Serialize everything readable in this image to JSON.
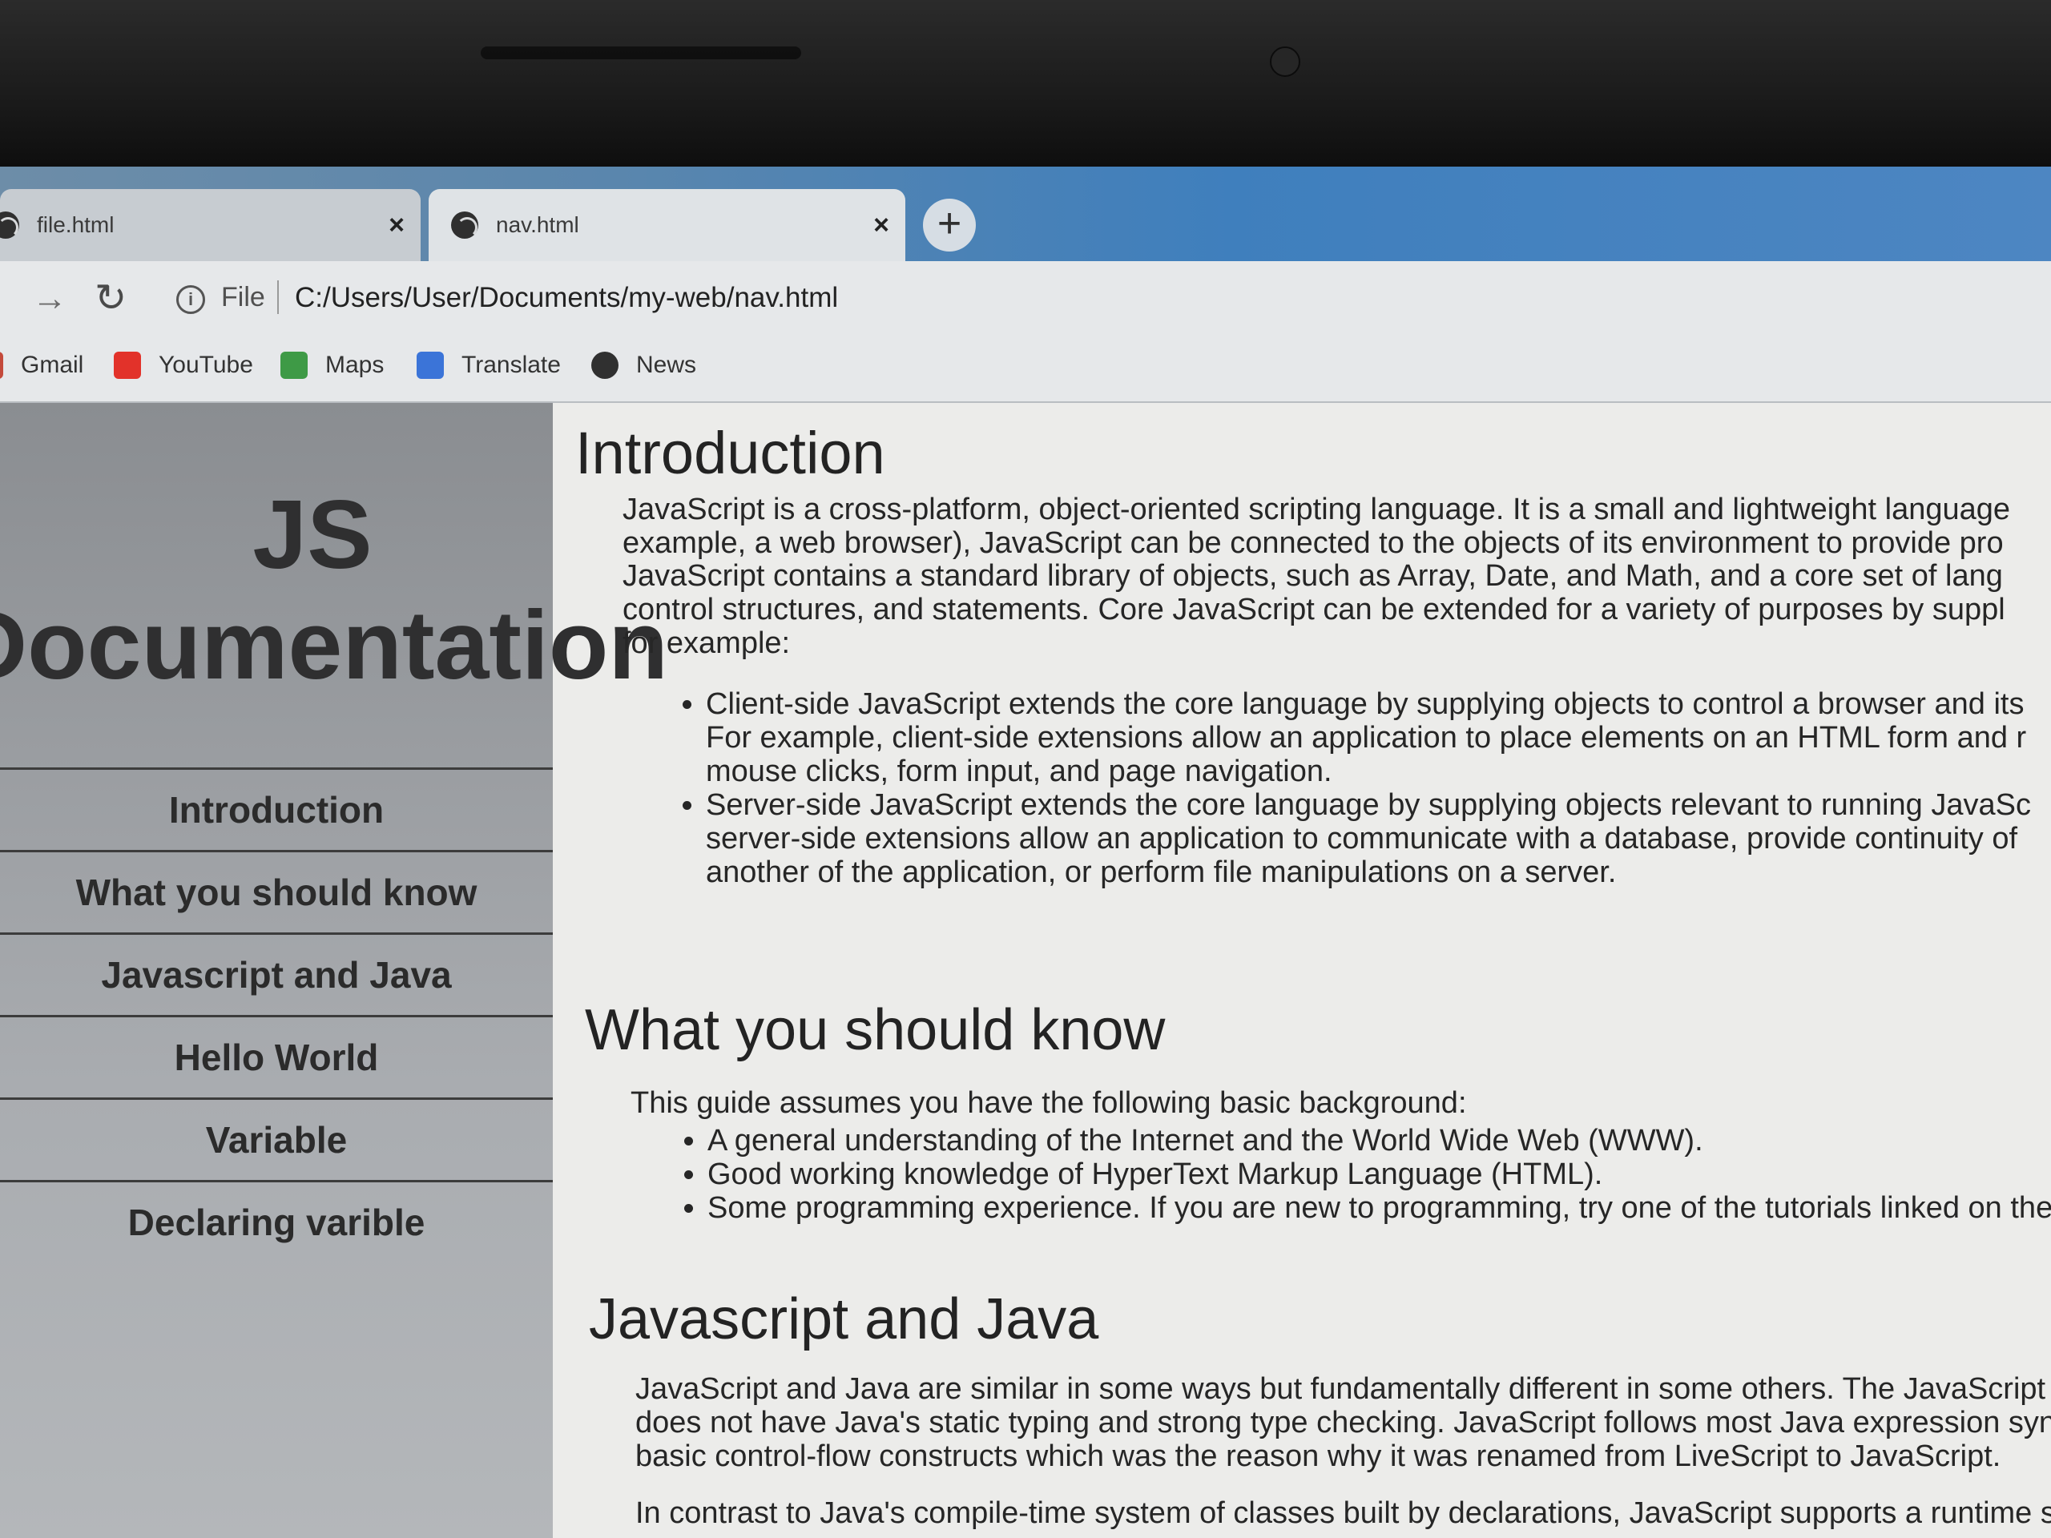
{
  "tabs": [
    {
      "title": "file.html",
      "close": "×"
    },
    {
      "title": "nav.html",
      "close": "×"
    }
  ],
  "new_tab_label": "+",
  "toolbar": {
    "forward_icon": "→",
    "reload_icon": "↻",
    "info_icon": "i",
    "scheme": "File",
    "url": "C:/Users/User/Documents/my-web/nav.html"
  },
  "bookmarks": [
    {
      "label": "Gmail",
      "icon": "gmail-icon",
      "color": "#c44a3b"
    },
    {
      "label": "YouTube",
      "icon": "youtube-icon",
      "color": "#e2322a"
    },
    {
      "label": "Maps",
      "icon": "maps-icon",
      "color": "#3e9a46"
    },
    {
      "label": "Translate",
      "icon": "translate-icon",
      "color": "#3b74d8"
    },
    {
      "label": "News",
      "icon": "news-icon",
      "color": "#303030"
    }
  ],
  "sidebar": {
    "title_line1": "JS",
    "title_line2": "Documentation",
    "items": [
      "Introduction",
      "What you should know",
      "Javascript and Java",
      "Hello World",
      "Variable",
      "Declaring varible"
    ]
  },
  "content": {
    "intro": {
      "heading": "Introduction",
      "p1_l1": "JavaScript is a cross-platform, object-oriented scripting language. It is a small and lightweight language",
      "p1_l2": "example, a web browser), JavaScript can be connected to the objects of its environment to provide pro",
      "p2_l1": "JavaScript contains a standard library of objects, such as Array, Date, and Math, and a core set of lang",
      "p2_l2": "control structures, and statements. Core JavaScript can be extended for a variety of purposes by suppl",
      "p2_l3": "for example:",
      "b1_l1": "Client-side JavaScript extends the core language by supplying objects to control a browser and its",
      "b1_l2": "For example, client-side extensions allow an application to place elements on an HTML form and r",
      "b1_l3": "mouse clicks, form input, and page navigation.",
      "b2_l1": "Server-side JavaScript extends the core language by supplying objects relevant to running JavaSc",
      "b2_l2": "server-side extensions allow an application to communicate with a database, provide continuity of",
      "b2_l3": "another of the application, or perform file manipulations on a server."
    },
    "know": {
      "heading": "What you should know",
      "p1": "This guide assumes you have the following basic background:",
      "b1": "A general understanding of the Internet and the World Wide Web (WWW).",
      "b2": "Good working knowledge of HyperText Markup Language (HTML).",
      "b3": "Some programming experience. If you are new to programming, try one of the tutorials linked on the"
    },
    "java": {
      "heading": "Javascript and Java",
      "p1_l1": "JavaScript and Java are similar in some ways but fundamentally different in some others. The JavaScript la",
      "p1_l2": "does not have Java's static typing and strong type checking. JavaScript follows most Java expression synta",
      "p1_l3": "basic control-flow constructs which was the reason why it was renamed from LiveScript to JavaScript.",
      "p2_l1": "In contrast to Java's compile-time system of classes built by declarations, JavaScript supports a runtime sys"
    }
  }
}
